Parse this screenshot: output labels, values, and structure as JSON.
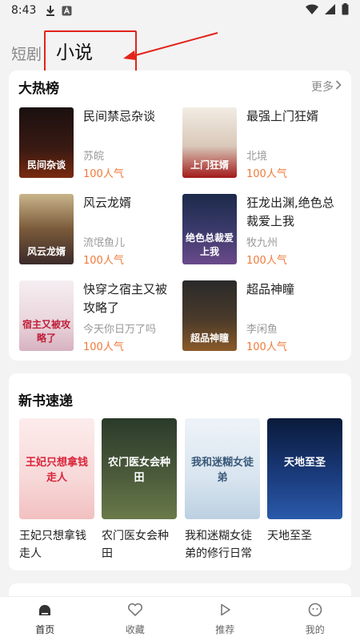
{
  "status_bar": {
    "time": "8:43"
  },
  "tabs": {
    "inactive": "短剧",
    "active": "小说"
  },
  "hot_rank": {
    "title": "大热榜",
    "more": "更多",
    "books": [
      {
        "title": "民间禁忌杂谈",
        "author": "苏皖",
        "popularity": "100人气",
        "cover_text": "民间杂谈"
      },
      {
        "title": "最强上门狂婿",
        "author": "北境",
        "popularity": "100人气",
        "cover_text": "上门狂婿"
      },
      {
        "title": "风云龙婿",
        "author": "流氓鱼儿",
        "popularity": "100人气",
        "cover_text": "风云龙婿"
      },
      {
        "title": "狂龙出渊,绝色总裁爱上我",
        "author": "牧九州",
        "popularity": "100人气",
        "cover_text": "绝色总裁爱上我"
      },
      {
        "title": "快穿之宿主又被攻略了",
        "author": "今天你日万了吗",
        "popularity": "100人气",
        "cover_text": "宿主又被攻略了"
      },
      {
        "title": "超品神瞳",
        "author": "李闲鱼",
        "popularity": "100人气",
        "cover_text": "超品神瞳"
      }
    ]
  },
  "new_books": {
    "title": "新书速递",
    "books": [
      {
        "title": "王妃只想拿钱走人",
        "cover_text": "王妃只想拿钱走人"
      },
      {
        "title": "农门医女会种田",
        "cover_text": "农门医女会种田"
      },
      {
        "title": "我和迷糊女徒弟的修行日常",
        "cover_text": "我和迷糊女徒弟"
      },
      {
        "title": "天地至圣",
        "cover_text": "天地至圣"
      }
    ]
  },
  "bottom_nav": [
    {
      "label": "首页",
      "icon": "home-icon"
    },
    {
      "label": "收藏",
      "icon": "heart-icon"
    },
    {
      "label": "推荐",
      "icon": "play-icon"
    },
    {
      "label": "我的",
      "icon": "profile-icon"
    }
  ]
}
